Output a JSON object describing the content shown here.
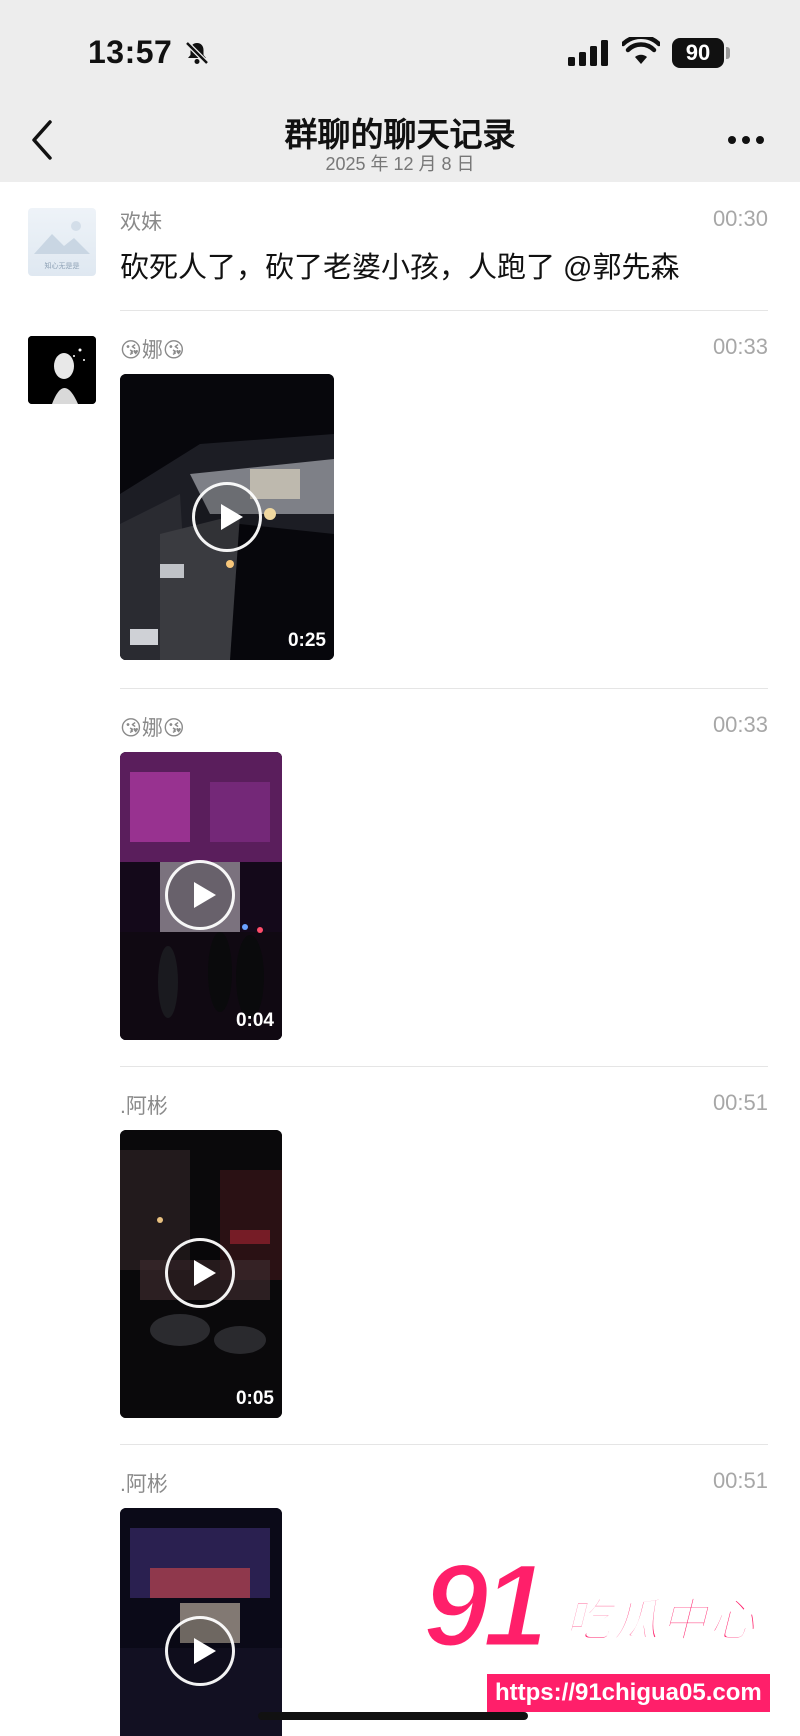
{
  "status_bar": {
    "time": "13:57",
    "battery": "90",
    "icons": [
      "bell-slash-icon",
      "signal-icon",
      "wifi-icon",
      "battery-icon"
    ]
  },
  "nav": {
    "title": "群聊的聊天记录",
    "subtitle": "2025 年 12 月 8 日",
    "back_icon": "chevron-left-icon",
    "more_icon": "more-dots-icon"
  },
  "messages": [
    {
      "sender": "欢妹",
      "time": "00:30",
      "type": "text",
      "text": "砍死人了，砍了老婆小孩，人跑了 @郭先森",
      "avatar_caption": "知心无是是"
    },
    {
      "sender": "😘娜😘",
      "time": "00:33",
      "type": "video",
      "duration": "0:25"
    },
    {
      "sender": "😘娜😘",
      "time": "00:33",
      "type": "video",
      "duration": "0:04"
    },
    {
      "sender": ".阿彬",
      "time": "00:51",
      "type": "video",
      "duration": "0:05"
    },
    {
      "sender": ".阿彬",
      "time": "00:51",
      "type": "video",
      "duration": ""
    }
  ],
  "watermark": {
    "number": "91",
    "name": "吃瓜中心",
    "url": "https://91chigua05.com"
  },
  "colors": {
    "header_bg": "#ededed",
    "watermark": "#ff1f6a",
    "divider": "#e5e5e5"
  }
}
